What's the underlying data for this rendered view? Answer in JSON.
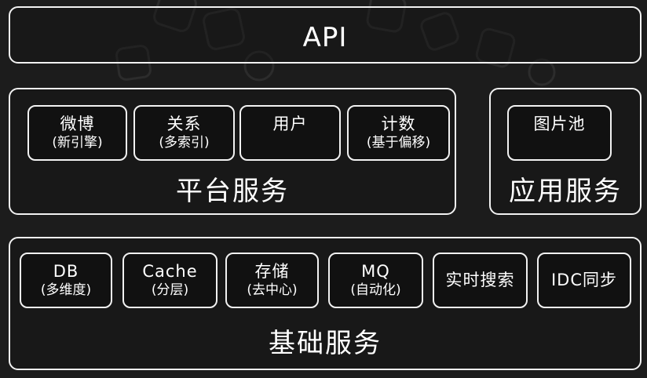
{
  "api": {
    "label": "API"
  },
  "platform": {
    "title": "平台服务",
    "items": [
      {
        "name": "微博",
        "sub": "(新引擎)"
      },
      {
        "name": "关系",
        "sub": "(多索引)"
      },
      {
        "name": "用户",
        "sub": ""
      },
      {
        "name": "计数",
        "sub": "(基于偏移)"
      }
    ]
  },
  "application": {
    "title": "应用服务",
    "items": [
      {
        "name": "图片池"
      }
    ]
  },
  "infrastructure": {
    "title": "基础服务",
    "items": [
      {
        "name": "DB",
        "sub": "(多维度)"
      },
      {
        "name": "Cache",
        "sub": "(分层)"
      },
      {
        "name": "存储",
        "sub": "(去中心)"
      },
      {
        "name": "MQ",
        "sub": "(自动化)"
      },
      {
        "name": "实时搜索",
        "sub": ""
      },
      {
        "name": "IDC同步",
        "sub": ""
      }
    ]
  },
  "colors": {
    "background": "#1c1c1c",
    "border": "#f2f2f2",
    "text": "#ffffff"
  }
}
